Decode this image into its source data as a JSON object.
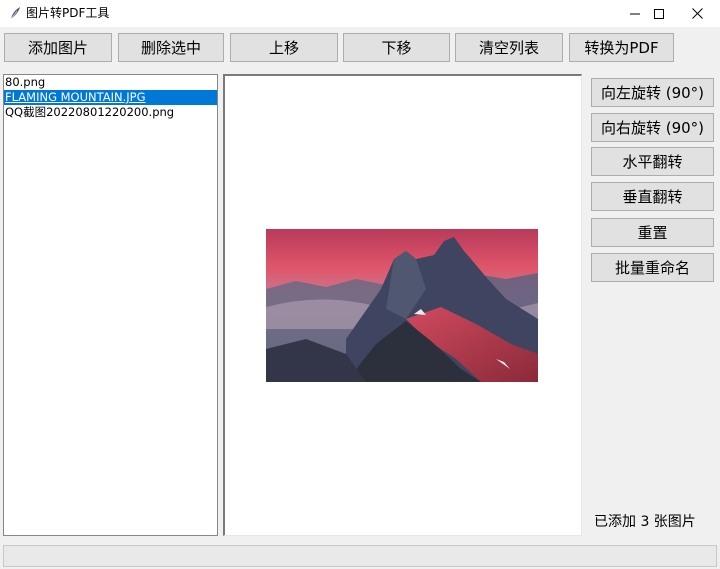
{
  "window": {
    "title": "图片转PDF工具",
    "icon": "feather-icon",
    "controls": {
      "minimize": "minimize-icon",
      "maximize": "maximize-icon",
      "close": "close-icon"
    }
  },
  "toolbar": {
    "add_images": "添加图片",
    "delete_selected": "删除选中",
    "move_up": "上移",
    "move_down": "下移",
    "clear_list": "清空列表",
    "convert_pdf": "转换为PDF"
  },
  "file_list": {
    "items": [
      {
        "label": "80.png",
        "selected": false
      },
      {
        "label": "FLAMING MOUNTAIN.JPG",
        "selected": true
      },
      {
        "label": "QQ截图20220801220200.png",
        "selected": false
      }
    ]
  },
  "side_panel": {
    "rotate_left": "向左旋转 (90°)",
    "rotate_right": "向右旋转 (90°)",
    "flip_horizontal": "水平翻转",
    "flip_vertical": "垂直翻转",
    "reset": "重置",
    "batch_rename": "批量重命名"
  },
  "status": {
    "count_text": "已添加 3 张图片"
  }
}
